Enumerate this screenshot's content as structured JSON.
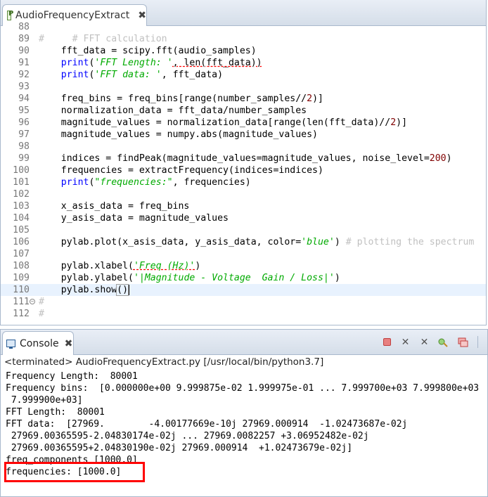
{
  "editor": {
    "tab_title": "AudioFrequencyExtract",
    "close_glyph": "✖",
    "lines": [
      {
        "num": "88",
        "segments": []
      },
      {
        "num": "89",
        "segments": [
          {
            "t": "#     # FFT calculation",
            "c": "cmt"
          }
        ]
      },
      {
        "num": "90",
        "segments": [
          {
            "t": "    fft_data = scipy.fft(audio_samples)",
            "c": ""
          }
        ]
      },
      {
        "num": "91",
        "segments": [
          {
            "t": "    ",
            "c": ""
          },
          {
            "t": "print",
            "c": "kw"
          },
          {
            "t": "(",
            "c": ""
          },
          {
            "t": "'FFT Length: '",
            "c": "str"
          },
          {
            "t": ", len(fft_data))",
            "c": ""
          }
        ]
      },
      {
        "num": "92",
        "segments": [
          {
            "t": "    ",
            "c": ""
          },
          {
            "t": "print",
            "c": "kw"
          },
          {
            "t": "(",
            "c": ""
          },
          {
            "t": "'FFT data: '",
            "c": "str"
          },
          {
            "t": ", fft_data)",
            "c": ""
          }
        ]
      },
      {
        "num": "93",
        "segments": []
      },
      {
        "num": "94",
        "segments": [
          {
            "t": "    freq_bins = freq_bins[range(number_samples//",
            "c": ""
          },
          {
            "t": "2",
            "c": "num"
          },
          {
            "t": ")]",
            "c": ""
          }
        ]
      },
      {
        "num": "95",
        "segments": [
          {
            "t": "    normalization_data = fft_data/number_samples",
            "c": ""
          }
        ]
      },
      {
        "num": "96",
        "segments": [
          {
            "t": "    magnitude_values = normalization_data[range(len(fft_data)//",
            "c": ""
          },
          {
            "t": "2",
            "c": "num"
          },
          {
            "t": ")]",
            "c": ""
          }
        ]
      },
      {
        "num": "97",
        "segments": [
          {
            "t": "    magnitude_values = numpy.abs(magnitude_values)",
            "c": ""
          }
        ]
      },
      {
        "num": "98",
        "segments": []
      },
      {
        "num": "99",
        "segments": [
          {
            "t": "    indices = findPeak(magnitude_values=magnitude_values, noise_level=",
            "c": ""
          },
          {
            "t": "200",
            "c": "num"
          },
          {
            "t": ")",
            "c": ""
          }
        ]
      },
      {
        "num": "100",
        "segments": [
          {
            "t": "    frequencies = extractFrequency(indices=indices)",
            "c": ""
          }
        ]
      },
      {
        "num": "101",
        "segments": [
          {
            "t": "    ",
            "c": ""
          },
          {
            "t": "print",
            "c": "kw"
          },
          {
            "t": "(",
            "c": ""
          },
          {
            "t": "\"frequencies:\"",
            "c": "str"
          },
          {
            "t": ", frequencies)",
            "c": ""
          }
        ]
      },
      {
        "num": "102",
        "segments": []
      },
      {
        "num": "103",
        "segments": [
          {
            "t": "    x_asis_data = freq_bins",
            "c": ""
          }
        ]
      },
      {
        "num": "104",
        "segments": [
          {
            "t": "    y_asis_data = magnitude_values",
            "c": ""
          }
        ]
      },
      {
        "num": "105",
        "segments": []
      },
      {
        "num": "106",
        "segments": [
          {
            "t": "    pylab.plot(x_asis_data, y_asis_data, color=",
            "c": ""
          },
          {
            "t": "'blue'",
            "c": "str"
          },
          {
            "t": ") ",
            "c": ""
          },
          {
            "t": "# plotting the spectrum",
            "c": "cmt"
          }
        ]
      },
      {
        "num": "107",
        "segments": []
      },
      {
        "num": "108",
        "segments": [
          {
            "t": "    pylab.xlabel(",
            "c": ""
          },
          {
            "t": "'Freq (Hz)'",
            "c": "str"
          },
          {
            "t": ")",
            "c": ""
          }
        ]
      },
      {
        "num": "109",
        "segments": [
          {
            "t": "    pylab.ylabel(",
            "c": ""
          },
          {
            "t": "'|Magnitude - Voltage  Gain / Loss|'",
            "c": "str"
          },
          {
            "t": ")",
            "c": ""
          }
        ]
      },
      {
        "num": "110",
        "segments": [
          {
            "t": "    pylab.show",
            "c": ""
          },
          {
            "t": "()",
            "c": "bracket"
          }
        ],
        "current": true
      },
      {
        "num": "111",
        "segments": [
          {
            "t": "#",
            "c": "cmt"
          }
        ],
        "fold": true
      },
      {
        "num": "112",
        "segments": [
          {
            "t": "#",
            "c": "cmt"
          }
        ]
      }
    ]
  },
  "console": {
    "tab_title": "Console",
    "close_glyph": "✖",
    "status": "<terminated> AudioFrequencyExtract.py [/usr/local/bin/python3.7]",
    "output": [
      "Frequency Length:  80001",
      "Frequency bins:  [0.000000e+00 9.999875e-02 1.999975e-01 ... 7.999700e+03 7.999800e+03",
      " 7.999900e+03]",
      "FFT Length:  80001",
      "FFT data:  [27969.        -4.00177669e-10j 27969.000914  -1.02473687e-02j",
      " 27969.00365595-2.04830174e-02j ... 27969.0082257 +3.06952482e-02j",
      " 27969.00365595+2.04830190e-02j 27969.000914  +1.02473679e-02j]",
      "freq_components [1000.0]",
      "frequencies: [1000.0]"
    ],
    "toolbar": [
      "terminate-icon",
      "remove-launch-icon",
      "remove-all-icon",
      "pin-console-icon",
      "display-selected-console-icon"
    ],
    "colors": {
      "terminate": "#e05050",
      "highlight": "#ff0000"
    }
  }
}
